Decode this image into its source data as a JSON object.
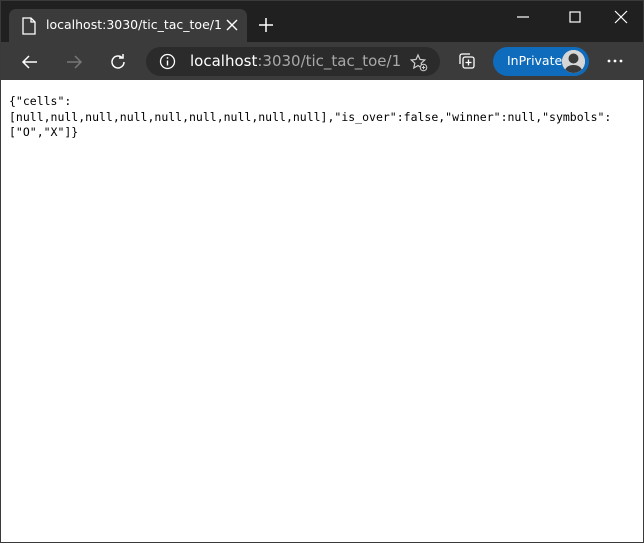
{
  "tab": {
    "title": "localhost:3030/tic_tac_toe/1",
    "page_icon": "page-icon",
    "close_icon": "close-icon"
  },
  "toolbar": {
    "back_icon": "back-arrow-icon",
    "forward_icon": "forward-arrow-icon",
    "refresh_icon": "refresh-icon",
    "address": {
      "host": "localhost",
      "rest": ":3030/tic_tac_toe/1",
      "info_icon": "info-icon",
      "favorite_icon": "add-favorite-icon"
    },
    "collections_icon": "collections-icon",
    "inprivate_label": "InPrivate",
    "menu_icon": "more-icon"
  },
  "page": {
    "json_lines": [
      "{\"cells\":",
      "[null,null,null,null,null,null,null,null,null],\"is_over\":false,\"winner\":null,\"symbols\":",
      "[\"O\",\"X\"]}"
    ]
  },
  "colors": {
    "tabstrip": "#202020",
    "toolbar": "#3b3b3b",
    "inprivate": "#0f6cbd"
  }
}
